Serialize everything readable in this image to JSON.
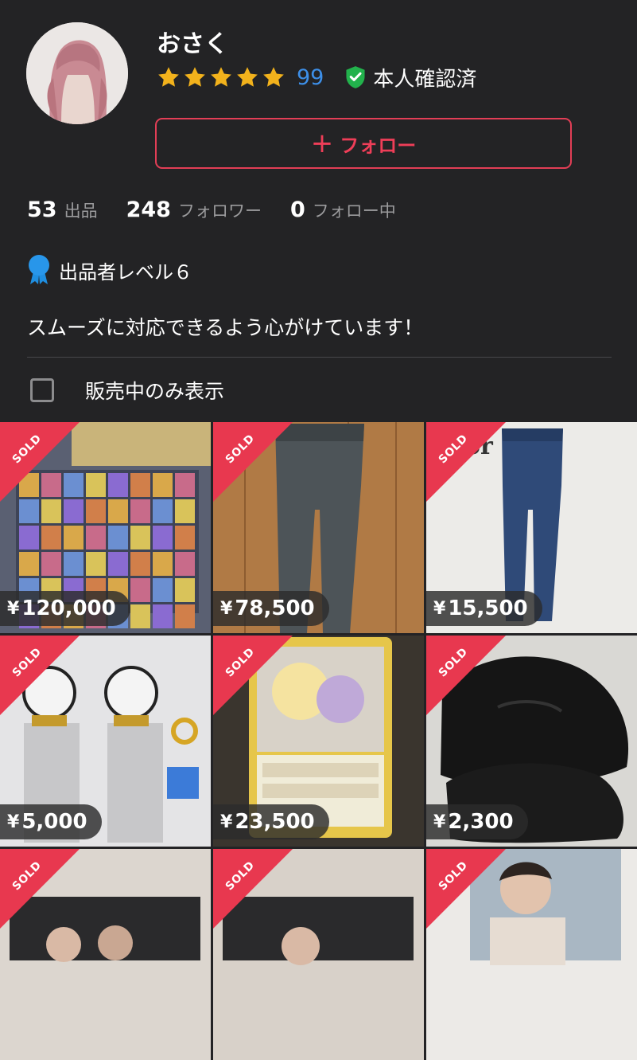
{
  "profile": {
    "name": "おさく",
    "rating_count": "99",
    "verified_label": "本人確認済",
    "follow_label": "フォロー",
    "stats": [
      {
        "num": "53",
        "label": "出品"
      },
      {
        "num": "248",
        "label": "フォロワー"
      },
      {
        "num": "0",
        "label": "フォロー中"
      }
    ],
    "level_label": "出品者レベル６",
    "bio": "スムーズに対応できるよう心がけています！",
    "filter_label": "販売中のみ表示"
  },
  "colors": {
    "background": "#232325",
    "accent": "#e23e56",
    "star": "#f2b21c",
    "link_blue": "#3d8fe8",
    "verified_green": "#22b24c"
  },
  "items": [
    {
      "badge": "SOLD",
      "yen": "¥",
      "price": "120,000",
      "image": "pokemon-card-collection"
    },
    {
      "badge": "SOLD",
      "yen": "¥",
      "price": "78,500",
      "image": "gray-jeans"
    },
    {
      "badge": "SOLD",
      "yen": "¥",
      "price": "15,500",
      "image": "blue-jeans"
    },
    {
      "badge": "SOLD",
      "yen": "¥",
      "price": "5,000",
      "image": "light-sticks"
    },
    {
      "badge": "SOLD",
      "yen": "¥",
      "price": "23,500",
      "image": "pokemon-tag-team-card"
    },
    {
      "badge": "SOLD",
      "yen": "¥",
      "price": "2,300",
      "image": "black-suede-shoes"
    },
    {
      "badge": "SOLD",
      "image": "photo-cards"
    },
    {
      "badge": "SOLD",
      "image": "photo-cards"
    },
    {
      "badge": "SOLD",
      "image": "portrait-photo"
    }
  ]
}
